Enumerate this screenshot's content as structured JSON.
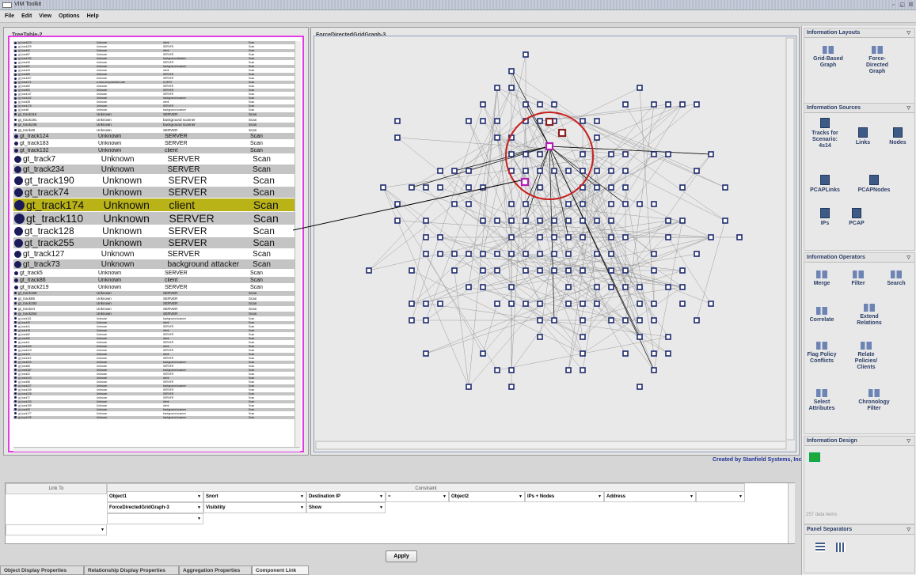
{
  "window": {
    "title": "VIM Toolkit",
    "controls": [
      "▫",
      "◱",
      "☒"
    ]
  },
  "menu": [
    "File",
    "Edit",
    "View",
    "Options",
    "Help"
  ],
  "tree_table": {
    "title": "TreeTable-2",
    "rows": [
      {
        "id": "gt_track210",
        "source": "Unknown",
        "role": "client",
        "type": "Scan",
        "size": "tiny"
      },
      {
        "id": "gt_track229",
        "source": "Unknown",
        "role": "SERVER",
        "type": "Scan",
        "size": "tiny"
      },
      {
        "id": "gt_track44",
        "source": "Unknown",
        "role": "client",
        "type": "Scan",
        "size": "tiny"
      },
      {
        "id": "gt_track57",
        "source": "Unknown",
        "role": "SERVER",
        "type": "Scan",
        "size": "tiny"
      },
      {
        "id": "gt_track102",
        "source": "Unknown",
        "role": "background attacker",
        "type": "Scan",
        "size": "tiny"
      },
      {
        "id": "gt_track33",
        "source": "Unknown",
        "role": "SERVER",
        "type": "Scan",
        "size": "tiny"
      },
      {
        "id": "gt_track61",
        "source": "Unknown",
        "role": "background scanner",
        "type": "Scan",
        "size": "tiny"
      },
      {
        "id": "gt_track15",
        "source": "Unknown",
        "role": "client",
        "type": "Scan",
        "size": "tiny"
      },
      {
        "id": "gt_track89",
        "source": "Unknown",
        "role": "SERVER",
        "type": "Scan",
        "size": "tiny"
      },
      {
        "id": "gt_track207",
        "source": "Unknown",
        "role": "SERVER",
        "type": "Scan",
        "size": "tiny"
      },
      {
        "id": "gt_track171",
        "source": "a-host-compromised-user",
        "role": "CLIENT",
        "type": "Scan",
        "size": "tiny"
      },
      {
        "id": "gt_track50",
        "source": "Unknown",
        "role": "SERVER",
        "type": "Scan",
        "size": "tiny"
      },
      {
        "id": "gt_track93",
        "source": "Unknown",
        "role": "SERVER",
        "type": "Scan",
        "size": "tiny"
      },
      {
        "id": "gt_track147",
        "source": "Unknown",
        "role": "SERVER",
        "type": "Scan",
        "size": "tiny"
      },
      {
        "id": "gt_track162",
        "source": "Unknown",
        "role": "background scanner",
        "type": "Scan",
        "size": "tiny"
      },
      {
        "id": "gt_track38",
        "source": "Unknown",
        "role": "client",
        "type": "Scan",
        "size": "tiny"
      },
      {
        "id": "gt_track176",
        "source": "Unknown",
        "role": "SERVER",
        "type": "Scan",
        "size": "tiny"
      },
      {
        "id": "gt_track8",
        "source": "Unknown",
        "role": "background scanner",
        "type": "Scan",
        "size": "tiny"
      },
      {
        "id": "gt_track116",
        "source": "Unknown",
        "role": "SERVER",
        "type": "Scan",
        "size": "s"
      },
      {
        "id": "gt_track191",
        "source": "Unknown",
        "role": "background scanner",
        "type": "Scan",
        "size": "s"
      },
      {
        "id": "gt_track236",
        "source": "Unknown",
        "role": "background scanner",
        "type": "Scan",
        "size": "s"
      },
      {
        "id": "gt_track48",
        "source": "Unknown",
        "role": "SERVER",
        "type": "Scan",
        "size": "s"
      },
      {
        "id": "gt_track124",
        "source": "Unknown",
        "role": "SERVER",
        "type": "Scan",
        "size": "m"
      },
      {
        "id": "gt_track183",
        "source": "Unknown",
        "role": "SERVER",
        "type": "Scan",
        "size": "m"
      },
      {
        "id": "gt_track132",
        "source": "Unknown",
        "role": "client",
        "type": "Scan",
        "size": "m"
      },
      {
        "id": "gt_track7",
        "source": "Unknown",
        "role": "SERVER",
        "type": "Scan",
        "size": "l"
      },
      {
        "id": "gt_track234",
        "source": "Unknown",
        "role": "SERVER",
        "type": "Scan",
        "size": "l"
      },
      {
        "id": "gt_track190",
        "source": "Unknown",
        "role": "SERVER",
        "type": "Scan",
        "size": "xl"
      },
      {
        "id": "gt_track74",
        "source": "Unknown",
        "role": "SERVER",
        "type": "Scan",
        "size": "xl"
      },
      {
        "id": "gt_track174",
        "source": "Unknown",
        "role": "client",
        "type": "Scan",
        "size": "xxl",
        "selected": true
      },
      {
        "id": "gt_track110",
        "source": "Unknown",
        "role": "SERVER",
        "type": "Scan",
        "size": "xxl"
      },
      {
        "id": "gt_track128",
        "source": "Unknown",
        "role": "SERVER",
        "type": "Scan",
        "size": "xl"
      },
      {
        "id": "gt_track255",
        "source": "Unknown",
        "role": "SERVER",
        "type": "Scan",
        "size": "xl"
      },
      {
        "id": "gt_track127",
        "source": "Unknown",
        "role": "SERVER",
        "type": "Scan",
        "size": "l"
      },
      {
        "id": "gt_track73",
        "source": "Unknown",
        "role": "background attacker",
        "type": "Scan",
        "size": "l"
      },
      {
        "id": "gt_track5",
        "source": "Unknown",
        "role": "SERVER",
        "type": "Scan",
        "size": "m"
      },
      {
        "id": "gt_track86",
        "source": "Unknown",
        "role": "client",
        "type": "Scan",
        "size": "m"
      },
      {
        "id": "gt_track219",
        "source": "Unknown",
        "role": "SERVER",
        "type": "Scan",
        "size": "m"
      },
      {
        "id": "gt_track166",
        "source": "Unknown",
        "role": "SERVER",
        "type": "Scan",
        "size": "s"
      },
      {
        "id": "gt_track85",
        "source": "Unknown",
        "role": "SERVER",
        "type": "Scan",
        "size": "s"
      },
      {
        "id": "gt_track192",
        "source": "Unknown",
        "role": "SERVER",
        "type": "Scan",
        "size": "s"
      },
      {
        "id": "gt_track24",
        "source": "Unknown",
        "role": "SERVER",
        "type": "Scan",
        "size": "s"
      },
      {
        "id": "gt_track252",
        "source": "Unknown",
        "role": "SERVER",
        "type": "Scan",
        "size": "s"
      },
      {
        "id": "gt_track141",
        "source": "Unknown",
        "role": "background scanner",
        "type": "Scan",
        "size": "tiny"
      },
      {
        "id": "gt_track29",
        "source": "Unknown",
        "role": "client",
        "type": "Scan",
        "size": "tiny"
      },
      {
        "id": "gt_track41",
        "source": "Unknown",
        "role": "SERVER",
        "type": "Scan",
        "size": "tiny"
      },
      {
        "id": "gt_track78",
        "source": "Unknown",
        "role": "client",
        "type": "Scan",
        "size": "tiny"
      },
      {
        "id": "gt_track62",
        "source": "Unknown",
        "role": "SERVER",
        "type": "Scan",
        "size": "tiny"
      },
      {
        "id": "gt_track99",
        "source": "Unknown",
        "role": "client",
        "type": "Scan",
        "size": "tiny"
      },
      {
        "id": "gt_track11",
        "source": "Unknown",
        "role": "SERVER",
        "type": "Scan",
        "size": "tiny"
      },
      {
        "id": "gt_track150",
        "source": "Unknown",
        "role": "client",
        "type": "Scan",
        "size": "tiny"
      },
      {
        "id": "gt_track213",
        "source": "Unknown",
        "role": "SERVER",
        "type": "Scan",
        "size": "tiny"
      },
      {
        "id": "gt_track34",
        "source": "Unknown",
        "role": "client",
        "type": "Scan",
        "size": "tiny"
      },
      {
        "id": "gt_track119",
        "source": "Unknown",
        "role": "SERVER",
        "type": "Scan",
        "size": "tiny"
      },
      {
        "id": "gt_track200",
        "source": "Unknown",
        "role": "background scanner",
        "type": "Scan",
        "size": "tiny"
      },
      {
        "id": "gt_track66",
        "source": "Unknown",
        "role": "SERVER",
        "type": "Scan",
        "size": "tiny"
      },
      {
        "id": "gt_track187",
        "source": "Unknown",
        "role": "background scanner",
        "type": "Scan",
        "size": "tiny"
      },
      {
        "id": "gt_track22",
        "source": "Unknown",
        "role": "SERVER",
        "type": "Scan",
        "size": "tiny"
      },
      {
        "id": "gt_track143",
        "source": "Unknown",
        "role": "client",
        "type": "Scan",
        "size": "tiny"
      },
      {
        "id": "gt_track58",
        "source": "Unknown",
        "role": "SERVER",
        "type": "Scan",
        "size": "tiny"
      },
      {
        "id": "gt_track227",
        "source": "Unknown",
        "role": "background scanner",
        "type": "Scan",
        "size": "tiny"
      },
      {
        "id": "gt_track105",
        "source": "Unknown",
        "role": "SERVER",
        "type": "Scan",
        "size": "tiny"
      },
      {
        "id": "gt_track228",
        "source": "Unknown",
        "role": "SERVER",
        "type": "Scan",
        "size": "tiny"
      },
      {
        "id": "gt_track77",
        "source": "Unknown",
        "role": "SERVER",
        "type": "Scan",
        "size": "tiny"
      },
      {
        "id": "gt_track130",
        "source": "Unknown",
        "role": "client",
        "type": "Scan",
        "size": "tiny"
      },
      {
        "id": "gt_track199",
        "source": "Unknown",
        "role": "client",
        "type": "Scan",
        "size": "tiny"
      },
      {
        "id": "gt_track25",
        "source": "Unknown",
        "role": "background scanner",
        "type": "Scan",
        "size": "tiny"
      },
      {
        "id": "gt_track177",
        "source": "Unknown",
        "role": "background scanner",
        "type": "Scan",
        "size": "tiny"
      },
      {
        "id": "gt_track139",
        "source": "Unknown",
        "role": "background scanner",
        "type": "Scan",
        "size": "tiny"
      }
    ]
  },
  "graph": {
    "title": "ForceDirectedGridGraph-3",
    "colors": {
      "node": "#1e2b6e",
      "highlight": "#b61cb6",
      "selected_ring": "#c8201e",
      "edge": "#8a8a8a"
    }
  },
  "credit": "Created by Stanfield Systems, Inc.",
  "right_panel": {
    "sections": [
      {
        "title": "Information Layouts",
        "items": [
          "Grid-Based Graph",
          "Force-Directed Graph"
        ]
      },
      {
        "title": "Information Sources",
        "items": [
          "Tracks for Scenario: 4s14",
          "Links",
          "Nodes",
          "PCAPLinks",
          "PCAPNodes",
          "IPs",
          "PCAP"
        ]
      },
      {
        "title": "Information Operators",
        "items": [
          "Merge",
          "Filter",
          "Search",
          "Correlate",
          "Extend Relations",
          "Flag Policy Conflicts",
          "Relate Policies/ Clients",
          "Select Attributes",
          "Chronology Filter"
        ]
      },
      {
        "title": "Information Design",
        "items": [
          "Tracks"
        ]
      },
      {
        "title": "Panel Separators",
        "items": []
      }
    ],
    "data_items": "257 data items"
  },
  "link_panel": {
    "headers": [
      "Link To",
      "Constraint"
    ],
    "row1": [
      "Object1",
      "Snort",
      "Destination IP",
      "=",
      "Object2",
      "IPs + Nodes",
      "Address",
      ""
    ],
    "row2": [
      "ForceDirectedGridGraph-3",
      "Visibility",
      "Show"
    ],
    "apply": "Apply"
  },
  "tabs": [
    "Object Display Properties",
    "Relationship Display Properties",
    "Aggregation Properties",
    "Component Link"
  ]
}
